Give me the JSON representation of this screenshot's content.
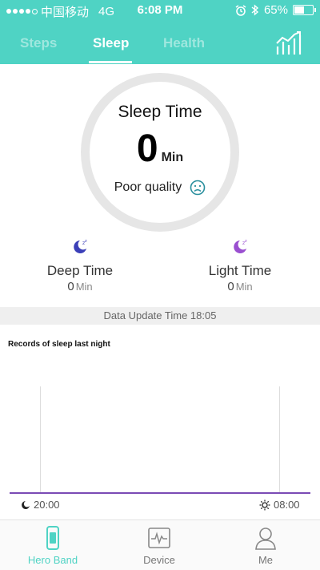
{
  "status": {
    "carrier": "中国移动",
    "network": "4G",
    "time": "6:08 PM",
    "battery": "65%",
    "battery_level": 0.65
  },
  "tabs": [
    {
      "label": "Steps",
      "active": false
    },
    {
      "label": "Sleep",
      "active": true
    },
    {
      "label": "Health",
      "active": false
    }
  ],
  "sleep": {
    "title": "Sleep Time",
    "value": "0",
    "unit": "Min",
    "quality": "Poor quality"
  },
  "metrics": {
    "deep": {
      "label": "Deep Time",
      "value": "0",
      "unit": "Min"
    },
    "light": {
      "label": "Light Time",
      "value": "0",
      "unit": "Min"
    }
  },
  "update_text": "Data Update Time 18:05",
  "records_title": "Records of sleep last night",
  "chart": {
    "start_time": "20:00",
    "end_time": "08:00"
  },
  "nav": [
    {
      "label": "Hero Band",
      "active": true,
      "icon": "band-icon"
    },
    {
      "label": "Device",
      "active": false,
      "icon": "device-icon"
    },
    {
      "label": "Me",
      "active": false,
      "icon": "user-icon"
    }
  ],
  "colors": {
    "accent": "#4fd3c4",
    "deep_moon": "#3b3fb8",
    "light_moon": "#9a4fd0",
    "chart_line": "#7a4bb5"
  }
}
